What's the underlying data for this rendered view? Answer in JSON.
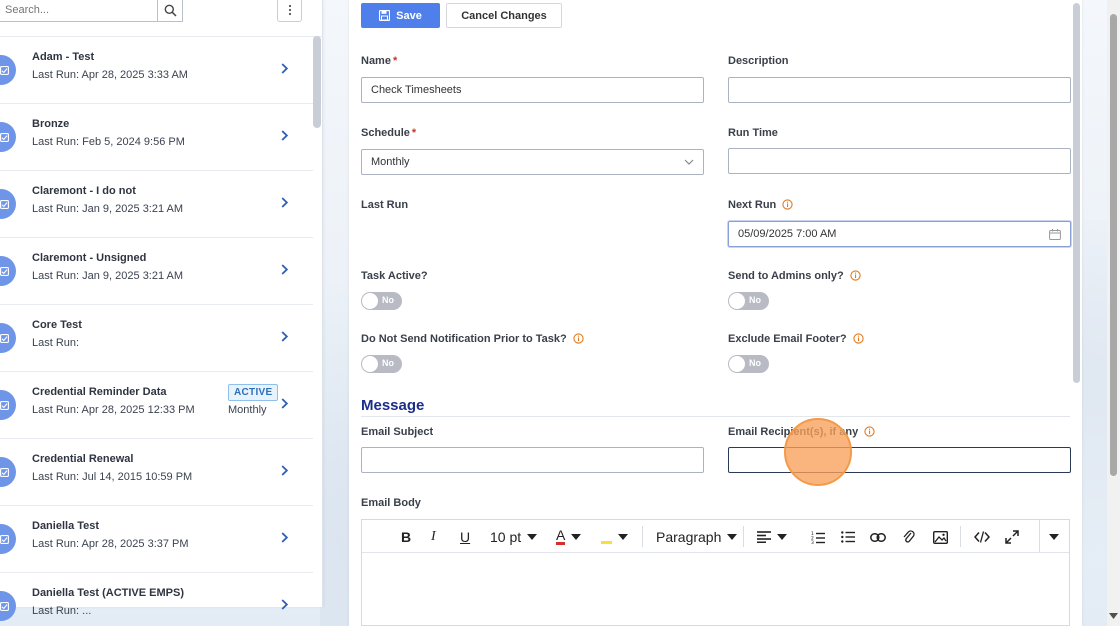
{
  "left": {
    "search_placeholder": "Search...",
    "tasks": [
      {
        "name": "Adam - Test",
        "last": "Last Run: Apr 28, 2025 3:33 AM"
      },
      {
        "name": "Bronze",
        "last": "Last Run: Feb 5, 2024 9:56 PM"
      },
      {
        "name": "Claremont - I do not",
        "last": "Last Run: Jan 9, 2025 3:21 AM"
      },
      {
        "name": "Claremont - Unsigned",
        "last": "Last Run: Jan 9, 2025 3:21 AM"
      },
      {
        "name": "Core Test",
        "last": "Last Run:"
      },
      {
        "name": "Credential Reminder Data",
        "last": "Last Run: Apr 28, 2025 12:33 PM",
        "badge": "ACTIVE",
        "freq": "Monthly"
      },
      {
        "name": "Credential Renewal",
        "last": "Last Run: Jul 14, 2015 10:59 PM"
      },
      {
        "name": "Daniella Test",
        "last": "Last Run: Apr 28, 2025 3:37 PM"
      },
      {
        "name": "Daniella Test (ACTIVE EMPS)",
        "last": "Last Run: ..."
      }
    ]
  },
  "toolbar": {
    "save_label": "Save",
    "cancel_label": "Cancel Changes"
  },
  "form": {
    "name_label": "Name",
    "name_value": "Check Timesheets",
    "description_label": "Description",
    "description_value": "",
    "schedule_label": "Schedule",
    "schedule_value": "Monthly",
    "runtime_label": "Run Time",
    "runtime_value": "",
    "lastrun_label": "Last Run",
    "nextrun_label": "Next Run",
    "nextrun_value": "05/09/2025 7:00 AM",
    "task_active_label": "Task Active?",
    "send_admins_label": "Send to Admins only?",
    "no_notify_label": "Do Not Send Notification Prior to Task?",
    "exclude_footer_label": "Exclude Email Footer?",
    "toggle_no": "No",
    "required_mark": "*"
  },
  "message": {
    "section_title": "Message",
    "subject_label": "Email Subject",
    "recipients_label": "Email Recipient(s), if any",
    "body_label": "Email Body"
  },
  "editor": {
    "font_size": "10 pt",
    "block_format": "Paragraph",
    "bold": "B",
    "italic": "I",
    "underline": "U",
    "font_color": "A"
  },
  "colors": {
    "primary": "#4f7fea",
    "section": "#1d2e8a",
    "info": "#e07b22",
    "avatar": "#6f95e8"
  }
}
